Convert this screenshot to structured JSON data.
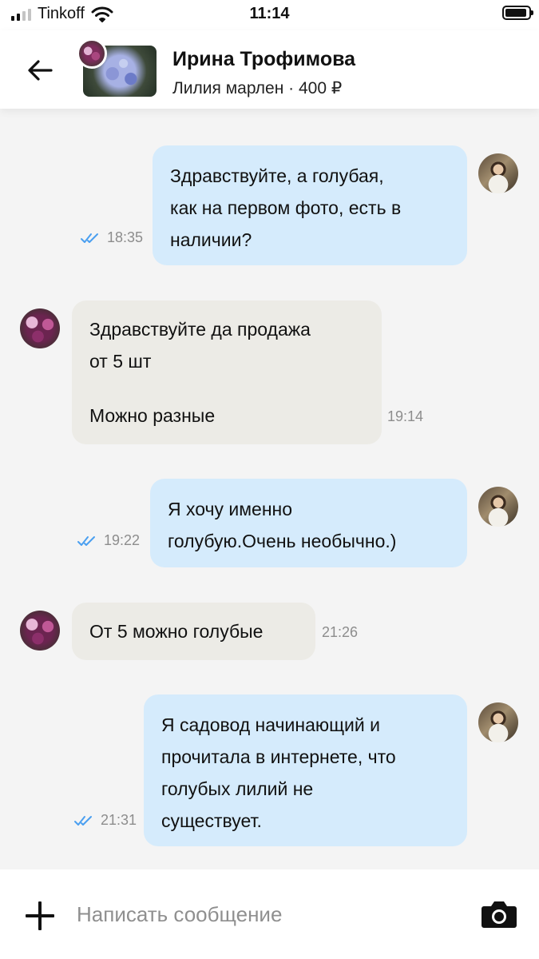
{
  "status_bar": {
    "carrier": "Tinkoff",
    "time": "11:14"
  },
  "header": {
    "contact_name": "Ирина Трофимова",
    "listing": "Лилия марлен · 400 ₽"
  },
  "messages": [
    {
      "direction": "out",
      "lines": [
        "Здравствуйте, а голубая,",
        "как на первом фото, есть в",
        "наличии?"
      ],
      "time": "18:35",
      "read": true
    },
    {
      "direction": "in",
      "lines": [
        "Здравствуйте да продажа",
        "от 5 шт",
        "",
        "Можно разные"
      ],
      "time": "19:14"
    },
    {
      "direction": "out",
      "lines": [
        "Я хочу именно",
        "голубую.Очень необычно.)"
      ],
      "time": "19:22",
      "read": true
    },
    {
      "direction": "in",
      "lines": [
        "От 5 можно голубые"
      ],
      "time": "21:26"
    },
    {
      "direction": "out",
      "lines": [
        "Я садовод начинающий и",
        "прочитала в интернете, что",
        "голубых лилий не",
        "существует."
      ],
      "time": "21:31",
      "read": true
    }
  ],
  "composer": {
    "placeholder": "Написать сообщение"
  },
  "colors": {
    "outgoing_bubble": "#d5ebfc",
    "incoming_bubble": "#ecebe6",
    "read_check": "#4a9ff0"
  }
}
